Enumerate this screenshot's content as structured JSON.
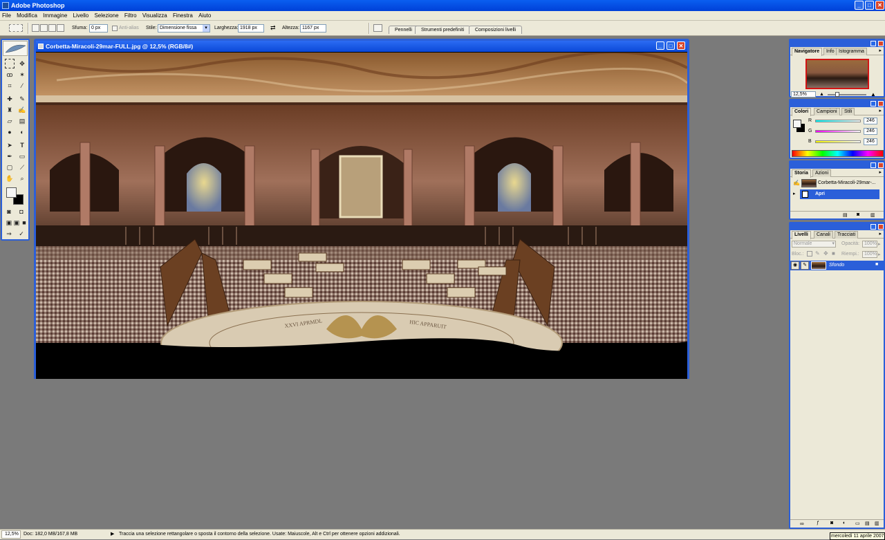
{
  "app": {
    "title": "Adobe Photoshop",
    "window_controls": {
      "minimize": "_",
      "maximize": "□",
      "close": "✕"
    }
  },
  "menu": [
    "File",
    "Modifica",
    "Immagine",
    "Livello",
    "Selezione",
    "Filtro",
    "Visualizza",
    "Finestra",
    "Aiuto"
  ],
  "options": {
    "sfuma_label": "Sfuma:",
    "sfuma_value": "0 px",
    "antialias_label": "Anti-alias",
    "stile_label": "Stile:",
    "stile_value": "Dimensione fissa",
    "larghezza_label": "Larghezza:",
    "larghezza_value": "1918 px",
    "altezza_label": "Altezza:",
    "altezza_value": "1167 px",
    "wells": [
      "Pennelli",
      "Strumenti predefiniti",
      "Composizioni livelli"
    ]
  },
  "document": {
    "title": "Corbetta-Miracoli-29mar-FULL.jpg @ 12,5% (RGB/8#)",
    "floor_text_left": "XXVI APRMDL",
    "floor_text_right": "HIC APPARUIT"
  },
  "navigator": {
    "tabs": [
      "Navigatore",
      "Info",
      "Istogramma"
    ],
    "zoom": "12,5%",
    "zoom_fraction": 0.25
  },
  "colors": {
    "tabs": [
      "Colori",
      "Campioni",
      "Stili"
    ],
    "channels": [
      {
        "label": "R",
        "value": "246"
      },
      {
        "label": "G",
        "value": "246"
      },
      {
        "label": "B",
        "value": "246"
      }
    ]
  },
  "history": {
    "tabs": [
      "Storia",
      "Azioni"
    ],
    "snapshot": "Corbetta-Miracoli-29mar-...",
    "state": "Apri"
  },
  "layers": {
    "tabs": [
      "Livelli",
      "Canali",
      "Tracciati"
    ],
    "blend_mode": "Normale",
    "opacity_label": "Opacità:",
    "opacity_value": "100%",
    "lock_label": "Bloc.:",
    "fill_label": "Riempi.:",
    "fill_value": "100%",
    "layer_name": "Sfondo"
  },
  "status": {
    "zoom": "12,5%",
    "doc_info": "Doc: 182,0 MB/167,8 MB",
    "hint": "Traccia una selezione rettangolare o sposta il contorno della selezione.  Usate: Maiuscole, Alt e Ctrl per ottenere opzioni addizionali.",
    "date": "mercoledì 11 aprile 2007"
  },
  "accent": "#2b5fd9"
}
